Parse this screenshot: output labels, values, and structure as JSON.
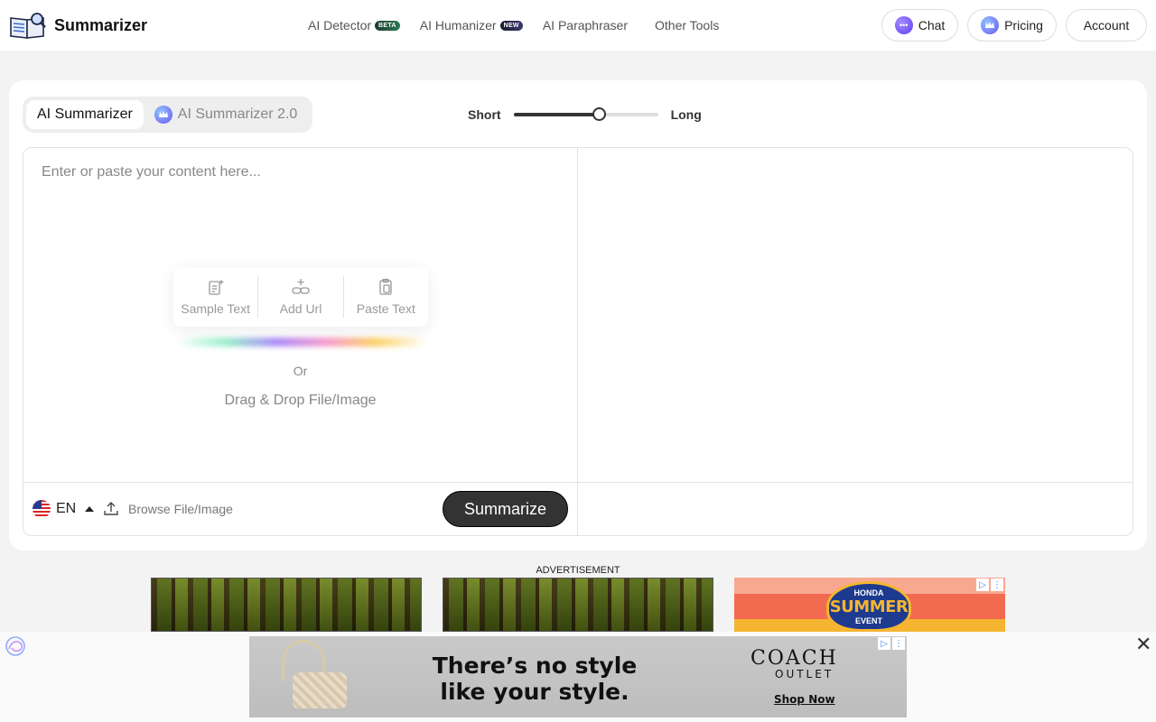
{
  "header": {
    "logo_text": "Summarizer",
    "nav": [
      {
        "label": "AI Detector",
        "badge": "BETA"
      },
      {
        "label": "AI Humanizer",
        "badge": "NEW"
      },
      {
        "label": "AI Paraphraser",
        "badge": ""
      },
      {
        "label": "Other Tools",
        "badge": ""
      }
    ],
    "chat_label": "Chat",
    "pricing_label": "Pricing",
    "account_label": "Account"
  },
  "modes": {
    "active": "AI Summarizer",
    "inactive": "AI Summarizer 2.0"
  },
  "length_slider": {
    "min_label": "Short",
    "max_label": "Long",
    "value": 0.59
  },
  "editor": {
    "placeholder": "Enter or paste your content here...",
    "quick_actions": [
      {
        "label": "Sample Text",
        "icon": "sample-text-icon"
      },
      {
        "label": "Add Url",
        "icon": "link-icon"
      },
      {
        "label": "Paste Text",
        "icon": "clipboard-icon"
      }
    ],
    "or_text": "Or",
    "drag_text": "Drag & Drop File/Image",
    "language": "EN",
    "browse_label": "Browse File/Image",
    "summarize_label": "Summarize"
  },
  "ads": {
    "label": "ADVERTISEMENT",
    "honda_brand": "HONDA",
    "honda_text": "SUMMER",
    "honda_sub": "EVENT",
    "coach_line1": "There’s no style",
    "coach_line2": "like your style.",
    "coach_brand": "COACH",
    "coach_outlet": "OUTLET",
    "coach_cta": "Shop Now"
  },
  "colors": {
    "primary_button": "#333333",
    "slider": "#333333",
    "page_bg": "#f3f3f4"
  }
}
